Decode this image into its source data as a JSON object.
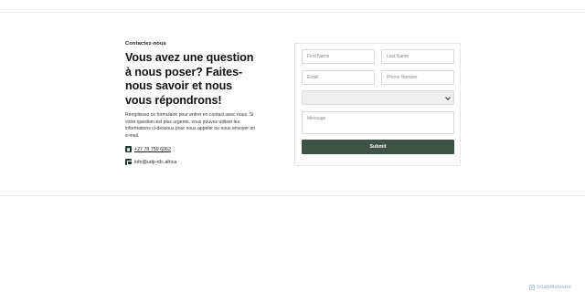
{
  "intro": {
    "eyebrow": "Contactez-nous",
    "heading": "Vous avez une question à nous poser? Faites-nous savoir et nous vous répondrons!",
    "description": "Remplissez ce formulaire pour entrer en contact avec nous. Si votre question est plus urgente, vous pouvez utiliser les informations ci-dessous pour nous appeler ou nous envoyer un e-mail."
  },
  "contacts": {
    "phone": {
      "icon": "phone-icon",
      "text": "+27 78 759 6062"
    },
    "email": {
      "icon": "mail-icon",
      "text": "info@udp-rdc.africa"
    }
  },
  "form": {
    "first_name_placeholder": "First Name",
    "last_name_placeholder": "Last Name",
    "email_placeholder": "Email",
    "phone_placeholder": "Phone Number",
    "select_value": "",
    "message_placeholder": "Message",
    "submit_label": "Submit"
  },
  "watermark": {
    "text": "ScanMalware",
    "icon": "scanmalware-logo-icon"
  },
  "colors": {
    "button": "#3e5345",
    "icon": "#1f3a2e",
    "select_bg": "#eeeeee"
  }
}
